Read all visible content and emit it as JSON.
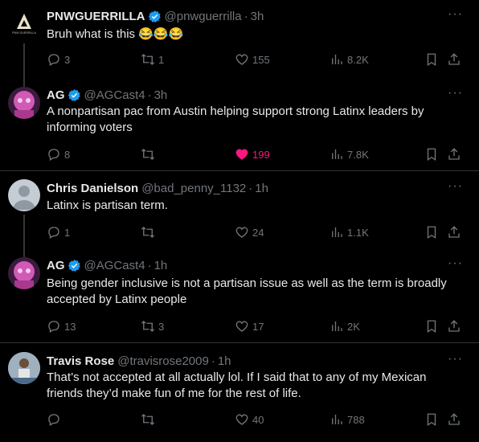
{
  "tweets": [
    {
      "name": "PNWGUERRILLA",
      "handle": "@pnwguerrilla",
      "time": "3h",
      "text": "Bruh what is this 😂😂😂",
      "replies": "3",
      "retweets": "1",
      "likes": "155",
      "views": "8.2K",
      "avatar": "pnwguerrilla-logo"
    },
    {
      "name": "AG",
      "handle": "@AGCast4",
      "time": "3h",
      "text": "A nonpartisan pac from Austin helping support strong Latinx leaders by informing voters",
      "replies": "8",
      "retweets": "",
      "likes": "199",
      "views": "7.8K",
      "avatar": "pink-character"
    },
    {
      "name": "Chris Danielson",
      "handle": "@bad_penny_1132",
      "time": "1h",
      "text": "Latinx is partisan term.",
      "replies": "1",
      "retweets": "",
      "likes": "24",
      "views": "1.1K",
      "avatar": "default-person"
    },
    {
      "name": "AG",
      "handle": "@AGCast4",
      "time": "1h",
      "text": "Being gender inclusive is not a partisan issue as well as the term is broadly accepted by Latinx people",
      "replies": "13",
      "retweets": "3",
      "likes": "17",
      "views": "2K",
      "avatar": "pink-character"
    },
    {
      "name": "Travis Rose",
      "handle": "@travisrose2009",
      "time": "1h",
      "text": "That’s not accepted at all actually lol. If I said that to any of my Mexican friends they’d make fun of me for the rest of life.",
      "replies": "",
      "retweets": "",
      "likes": "40",
      "views": "788",
      "avatar": "photo-person"
    }
  ],
  "ui": {
    "dot": "·",
    "more": "···",
    "logo_text": "PNW GUERRILLA"
  },
  "colors": {
    "background": "#000000",
    "text": "#e7e9ea",
    "muted": "#71767b",
    "verified": "#1d9bf0",
    "like": "#f91880",
    "divider": "#2f3336"
  }
}
